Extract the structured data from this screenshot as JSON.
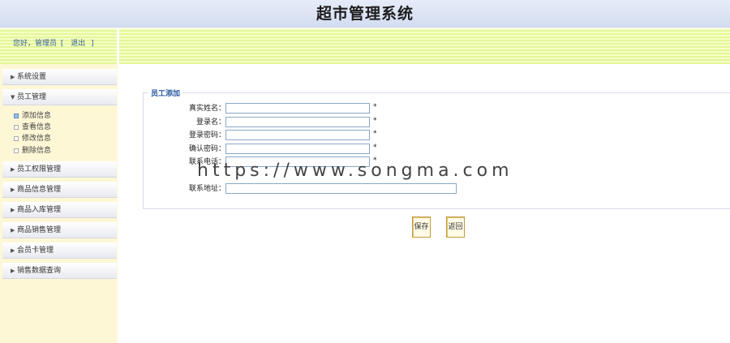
{
  "header": {
    "title": "超市管理系统"
  },
  "topbar": {
    "greeting": "您好，管理员",
    "bracket_open": "[",
    "logout": "退出",
    "bracket_close": "]"
  },
  "sidebar": {
    "menus": [
      {
        "label": "系统设置"
      },
      {
        "label": "员工管理"
      },
      {
        "label": "员工权限管理"
      },
      {
        "label": "商品信息管理"
      },
      {
        "label": "商品入库管理"
      },
      {
        "label": "商品销售管理"
      },
      {
        "label": "会员卡管理"
      },
      {
        "label": "销售数据查询"
      }
    ],
    "submenu": [
      {
        "label": "添加信息"
      },
      {
        "label": "查看信息"
      },
      {
        "label": "修改信息"
      },
      {
        "label": "删除信息"
      }
    ]
  },
  "form": {
    "legend": "员工添加",
    "fields": [
      {
        "label": "真实姓名：",
        "value": "",
        "required": "*"
      },
      {
        "label": "登录名：",
        "value": "",
        "required": "*"
      },
      {
        "label": "登录密码：",
        "value": "",
        "required": "*"
      },
      {
        "label": "确认密码：",
        "value": "",
        "required": "*"
      },
      {
        "label": "联系电话：",
        "value": "",
        "required": "*"
      },
      {
        "label": "联系地址：",
        "value": ""
      }
    ],
    "save": "保存",
    "back": "返回"
  },
  "watermark": "https://www.songma.com",
  "colors": {
    "header_bg": "#dbe3f4",
    "greenbar": "#e8f9a8",
    "sidebar_bg": "#fdf7d6",
    "legend": "#2b58a0",
    "required": "#dd0000"
  }
}
